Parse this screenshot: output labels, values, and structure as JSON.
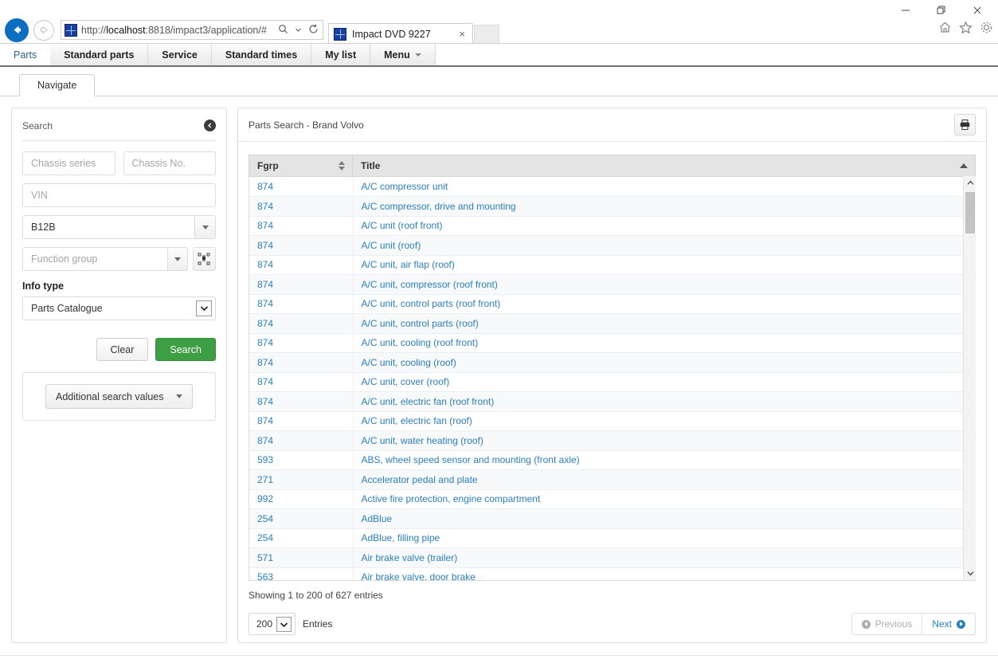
{
  "browser": {
    "url_prefix": "http://",
    "url_host": "localhost",
    "url_rest": ":8818/impact3/application/#",
    "back_icon": "back-arrow-icon",
    "forward_icon": "forward-arrow-icon",
    "search_icon": "magnifier-icon",
    "dropdown_icon": "chevron-down-icon",
    "refresh_icon": "refresh-icon",
    "tab_title": "Impact DVD 9227",
    "tab_close": "×",
    "minimize": "minimize-icon",
    "restore": "restore-icon",
    "close": "close-icon",
    "home_icon": "home-icon",
    "favorites_icon": "star-icon",
    "settings_icon": "gear-icon"
  },
  "app_nav": {
    "items": [
      {
        "label": "Parts",
        "active": true,
        "caret": false
      },
      {
        "label": "Standard parts",
        "active": false,
        "caret": false
      },
      {
        "label": "Service",
        "active": false,
        "caret": false
      },
      {
        "label": "Standard times",
        "active": false,
        "caret": false
      },
      {
        "label": "My list",
        "active": false,
        "caret": false
      },
      {
        "label": "Menu",
        "active": false,
        "caret": true
      }
    ]
  },
  "sub_tabs": [
    {
      "label": "Navigate",
      "active": true
    }
  ],
  "sidebar": {
    "title": "Search",
    "collapse_icon": "collapse-left-icon",
    "chassis_series_placeholder": "Chassis series",
    "chassis_series_value": "",
    "chassis_no_placeholder": "Chassis No.",
    "chassis_no_value": "",
    "vin_placeholder": "VIN",
    "vin_value": "",
    "model_value": "B12B",
    "model_placeholder": "",
    "function_group_placeholder": "Function group",
    "function_group_value": "",
    "tree_button_icon": "function-group-tree-icon",
    "info_type_label": "Info type",
    "info_type_value": "Parts Catalogue",
    "clear_label": "Clear",
    "search_label": "Search",
    "additional_search_label": "Additional search values"
  },
  "main": {
    "header_title": "Parts Search - Brand Volvo",
    "print_icon": "printer-icon",
    "columns": [
      {
        "key": "fgrp",
        "label": "Fgrp",
        "sort": "both"
      },
      {
        "key": "title",
        "label": "Title",
        "sort": "asc"
      }
    ],
    "rows": [
      {
        "fgrp": "874",
        "title": "A/C compressor unit"
      },
      {
        "fgrp": "874",
        "title": "A/C compressor, drive and mounting"
      },
      {
        "fgrp": "874",
        "title": "A/C unit (roof front)"
      },
      {
        "fgrp": "874",
        "title": "A/C unit (roof)"
      },
      {
        "fgrp": "874",
        "title": "A/C unit, air flap (roof)"
      },
      {
        "fgrp": "874",
        "title": "A/C unit, compressor (roof front)"
      },
      {
        "fgrp": "874",
        "title": "A/C unit, control parts (roof front)"
      },
      {
        "fgrp": "874",
        "title": "A/C unit, control parts (roof)"
      },
      {
        "fgrp": "874",
        "title": "A/C unit, cooling (roof front)"
      },
      {
        "fgrp": "874",
        "title": "A/C unit, cooling (roof)"
      },
      {
        "fgrp": "874",
        "title": "A/C unit, cover (roof)"
      },
      {
        "fgrp": "874",
        "title": "A/C unit, electric fan (roof front)"
      },
      {
        "fgrp": "874",
        "title": "A/C unit, electric fan (roof)"
      },
      {
        "fgrp": "874",
        "title": "A/C unit, water heating (roof)"
      },
      {
        "fgrp": "593",
        "title": "ABS, wheel speed sensor and mounting (front axle)"
      },
      {
        "fgrp": "271",
        "title": "Accelerator pedal and plate"
      },
      {
        "fgrp": "992",
        "title": "Active fire protection, engine compartment"
      },
      {
        "fgrp": "254",
        "title": "AdBlue"
      },
      {
        "fgrp": "254",
        "title": "AdBlue, filling pipe"
      },
      {
        "fgrp": "571",
        "title": "Air brake valve (trailer)"
      },
      {
        "fgrp": "563",
        "title": "Air brake valve, door brake"
      }
    ],
    "showing_text": "Showing 1 to 200 of 627 entries",
    "entries_value": "200",
    "entries_label": "Entries",
    "previous_label": "Previous",
    "next_label": "Next",
    "scroll_up_icon": "scroll-up-icon",
    "scroll_down_icon": "scroll-down-icon"
  },
  "colors": {
    "link_blue": "#2a7fc0",
    "primary_green": "#3e9e43",
    "ie_blue": "#0b6ec1",
    "header_gray": "#e4e4e4"
  }
}
